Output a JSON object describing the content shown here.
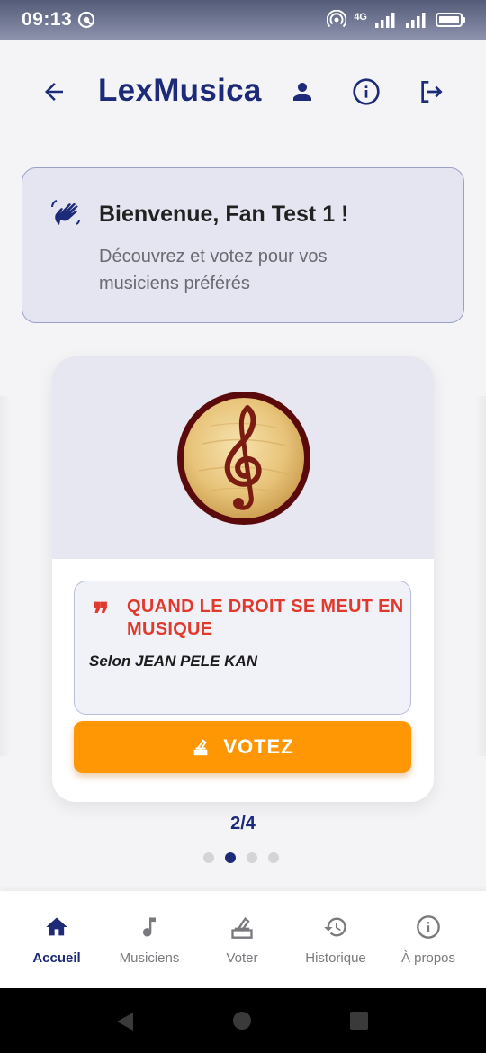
{
  "status_bar": {
    "time": "09:13",
    "network": "4G"
  },
  "header": {
    "title": "LexMusica",
    "icons": [
      "arrow-back-icon",
      "person-icon",
      "info-icon",
      "logout-icon"
    ]
  },
  "welcome": {
    "title": "Bienvenue, Fan Test 1 !",
    "subtitle": "Découvrez et votez pour vos musiciens préférés"
  },
  "musician_card": {
    "quote_title": "QUAND LE DROIT SE MEUT EN MUSIQUE",
    "author": "Selon JEAN PELE KAN",
    "vote_label": "VOTEZ"
  },
  "pagination": {
    "label": "2/4",
    "current": 2,
    "total": 4
  },
  "bottom_nav": {
    "items": [
      {
        "label": "Accueil",
        "icon": "home-icon",
        "active": true
      },
      {
        "label": "Musiciens",
        "icon": "music-note-icon",
        "active": false
      },
      {
        "label": "Voter",
        "icon": "ballot-icon",
        "active": false
      },
      {
        "label": "Historique",
        "icon": "history-icon",
        "active": false
      },
      {
        "label": "À propos",
        "icon": "info-icon",
        "active": false
      }
    ]
  },
  "colors": {
    "primary": "#1c2a78",
    "accent_orange": "#ff9705",
    "quote_red": "#e03a2e",
    "welcome_bg": "#e4e5f0"
  }
}
